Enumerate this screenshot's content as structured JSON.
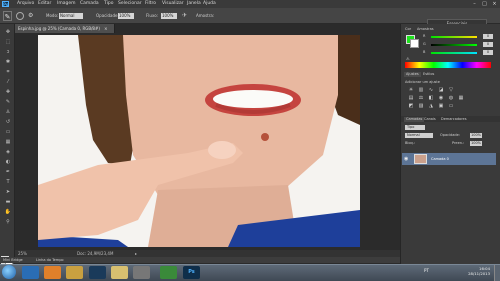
{
  "app": {
    "logo": "Ps"
  },
  "menu": [
    "Arquivo",
    "Editar",
    "Imagem",
    "Camada",
    "Tipo",
    "Selecionar",
    "Filtro",
    "Visualizar",
    "Janela",
    "Ajuda"
  ],
  "options": {
    "mode_label": "Modo:",
    "mode_value": "Normal",
    "opacity_label": "Opacidade:",
    "opacity_value": "100%",
    "flow_label": "Fluxo:",
    "flow_value": "100%",
    "source_label": "Amostra:"
  },
  "workspace": "Essenciais",
  "document": {
    "tab_title": "Espinha.jpg @ 25% (Camada 0, RGB/8#)",
    "tab_close": "×"
  },
  "status": {
    "zoom": "25%",
    "doc_info": "Doc: 24,9M/23,4M",
    "arrow": "▸"
  },
  "minibridge": {
    "tab1": "Mini Bridge",
    "tab2": "Linha do Tempo"
  },
  "color_panel": {
    "tab_color": "Cor",
    "tab_swatches": "Amostras",
    "r": "0",
    "g": "0",
    "b": "0",
    "fg_color": "#1ee21e"
  },
  "adjustments": {
    "tab_adjust": "Ajustes",
    "tab_styles": "Estilos",
    "title": "Adicionar um ajuste"
  },
  "layers": {
    "tab_layers": "Camadas",
    "tab_channels": "Canais",
    "tab_paths": "Demarcadores",
    "kind_label": "Tipo",
    "blend": "Normal",
    "opacity_label": "Opacidade:",
    "opacity_value": "100%",
    "lock_label": "Bloq.:",
    "fill_label": "Preen.:",
    "fill_value": "100%",
    "layer_name": "Camada 0"
  },
  "taskbar": {
    "language": "PT",
    "time": "16:04",
    "date": "28/11/2013"
  }
}
